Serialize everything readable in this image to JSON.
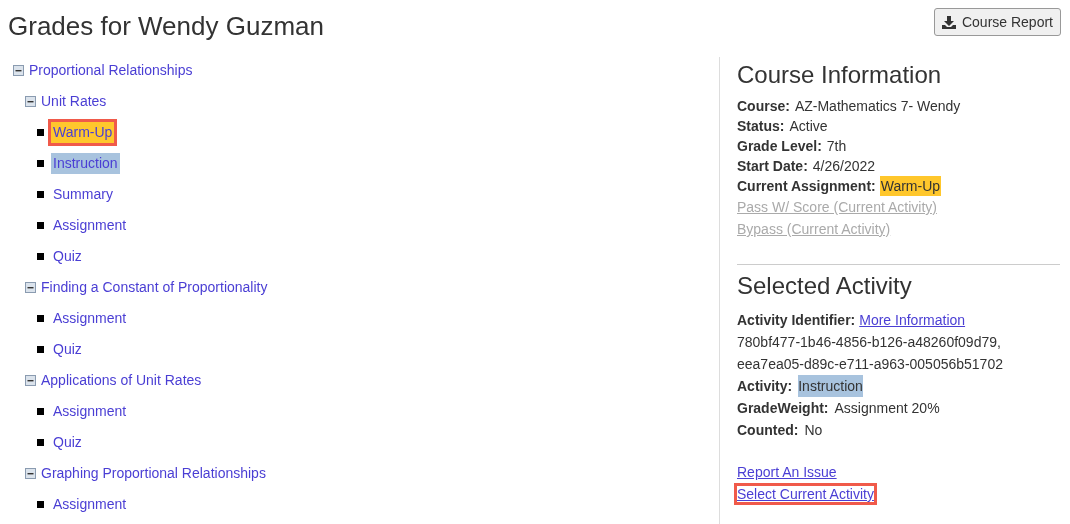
{
  "page": {
    "title": "Grades for Wendy Guzman",
    "report_button": "Course Report"
  },
  "tree": [
    {
      "label": "Proportional Relationships",
      "expanded": true,
      "children": [
        {
          "label": "Unit Rates",
          "expanded": true,
          "children": [
            {
              "label": "Warm-Up",
              "current": true,
              "selected": false,
              "outlined": true
            },
            {
              "label": "Instruction",
              "current": false,
              "selected": true,
              "outlined": false
            },
            {
              "label": "Summary",
              "current": false,
              "selected": false,
              "outlined": false
            },
            {
              "label": "Assignment",
              "current": false,
              "selected": false,
              "outlined": false
            },
            {
              "label": "Quiz",
              "current": false,
              "selected": false,
              "outlined": false
            }
          ]
        },
        {
          "label": "Finding a Constant of Proportionality",
          "expanded": true,
          "children": [
            {
              "label": "Assignment",
              "current": false,
              "selected": false,
              "outlined": false
            },
            {
              "label": "Quiz",
              "current": false,
              "selected": false,
              "outlined": false
            }
          ]
        },
        {
          "label": "Applications of Unit Rates",
          "expanded": true,
          "children": [
            {
              "label": "Assignment",
              "current": false,
              "selected": false,
              "outlined": false
            },
            {
              "label": "Quiz",
              "current": false,
              "selected": false,
              "outlined": false
            }
          ]
        },
        {
          "label": "Graphing Proportional Relationships",
          "expanded": true,
          "children": [
            {
              "label": "Assignment",
              "current": false,
              "selected": false,
              "outlined": false
            }
          ]
        }
      ]
    }
  ],
  "course_info": {
    "title": "Course Information",
    "fields": [
      {
        "label": "Course:",
        "value": "AZ-Mathematics 7- Wendy",
        "current": false,
        "selected": false
      },
      {
        "label": "Status:",
        "value": "Active",
        "current": false,
        "selected": false
      },
      {
        "label": "Grade Level:",
        "value": "7th",
        "current": false,
        "selected": false
      },
      {
        "label": "Start Date:",
        "value": "4/26/2022",
        "current": false,
        "selected": false
      },
      {
        "label": "Current Assignment:",
        "value": "Warm-Up",
        "current": true,
        "selected": false
      }
    ],
    "actions": [
      {
        "label": "Pass W/ Score (Current Activity)",
        "disabled": true
      },
      {
        "label": "Bypass (Current Activity)",
        "disabled": true
      }
    ]
  },
  "selected_activity": {
    "title": "Selected Activity",
    "identifier_label": "Activity Identifier:",
    "identifier_link": "More Information",
    "identifiers": [
      "780bf477-1b46-4856-b126-a48260f09d79,",
      "eea7ea05-d89c-e711-a963-005056b51702"
    ],
    "fields": [
      {
        "label": "Activity:",
        "value": "Instruction",
        "current": false,
        "selected": true
      },
      {
        "label": "GradeWeight:",
        "value": "Assignment 20%",
        "current": false,
        "selected": false
      },
      {
        "label": "Counted:",
        "value": "No",
        "current": false,
        "selected": false
      }
    ],
    "links": [
      {
        "label": "Report An Issue",
        "outlined": false
      },
      {
        "label": "Select Current Activity",
        "outlined": true
      }
    ]
  }
}
